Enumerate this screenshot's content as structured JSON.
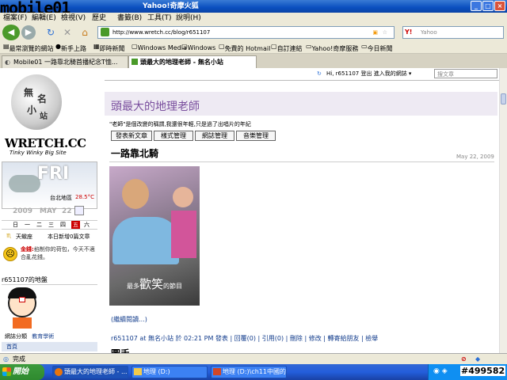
{
  "window": {
    "title": "Yahoo!奇摩火狐",
    "overlay_logo": "mobile01"
  },
  "menu": [
    "檔案(F)",
    "編輯(E)",
    "檢視(V)",
    "歷史",
    "書籤(B)",
    "工具(T)",
    "說明(H)"
  ],
  "nav": {
    "url": "http://www.wretch.cc/blog/r651107",
    "search_placeholder": "Yahoo"
  },
  "bookmarks": [
    "最常瀏覽的網站",
    "新手上路",
    "即時新聞",
    "Windows Media",
    "Windows",
    "免費的 Hotmail",
    "自訂連結",
    "Yahoo!奇摩服務",
    "今日新聞"
  ],
  "tabs": [
    {
      "label": "Mobile01 一路靠北騎首播紀念T恤..."
    },
    {
      "label": "頭最大的地理老師 - 無名小站"
    }
  ],
  "site": {
    "user_bar": "Hi, r651107  登出  進入我的網誌 ▾",
    "search_placeholder": "搜文章",
    "logo_text": "WRETCH.CC",
    "logo_tagline": "Tinky Winky Big Site",
    "blog_title": "頭最大的地理老師",
    "blog_desc": "\"老師\"是個改變的稱謂,我還很年輕,只是過了出唱片的年紀",
    "buttons": [
      "發表新文章",
      "樣式管理",
      "網誌管理",
      "音樂管理"
    ],
    "post": {
      "title": "一路靠北騎",
      "date": "May 22, 2009",
      "photo_caption_pre": "最多",
      "photo_caption_big": "歡笑",
      "photo_caption_post": "的節目",
      "read_more": "(繼續閱讀...)",
      "footer": "r651107 at 無名小站 於 02:21 PM 發表 | 回覆(0) | 引用(0) | 刪除 | 修改 | 轉寄給朋友 | 檢舉",
      "next_title": "圖手"
    },
    "sidebar": {
      "weather_day": "FRI",
      "weather_loc": "台北地區",
      "weather_temp": "28.5°C",
      "date_year": "2009",
      "date_month": "MAY",
      "date_day": "22",
      "weekdays": [
        "日",
        "一",
        "二",
        "三",
        "四",
        "五",
        "六"
      ],
      "weekday_active_index": 5,
      "stats_name": "天蠍座",
      "stats_count": "本日新增0篇文章",
      "fortune_label": "金錢:",
      "fortune_text": "掐制你的荷包，今天不適合亂花錢。",
      "profile_title": "r651107的地盤",
      "category_label": "網誌分類",
      "category_value": "教育學術",
      "home_link": "首頁"
    }
  },
  "status": {
    "text": "完成"
  },
  "taskbar": {
    "start": "開始",
    "tasks": [
      "頭最大的地理老師 - ...",
      "地理 (D:)",
      "地理 (D:)\\ch11中國的..."
    ],
    "watermark": "#499582"
  },
  "colors": {
    "title_blue": "#0a4fbf",
    "link_blue": "#123c8c",
    "blog_title_purple": "#7a4f9e",
    "taskbar_blue": "#245edb",
    "start_green": "#2f8a2f"
  }
}
